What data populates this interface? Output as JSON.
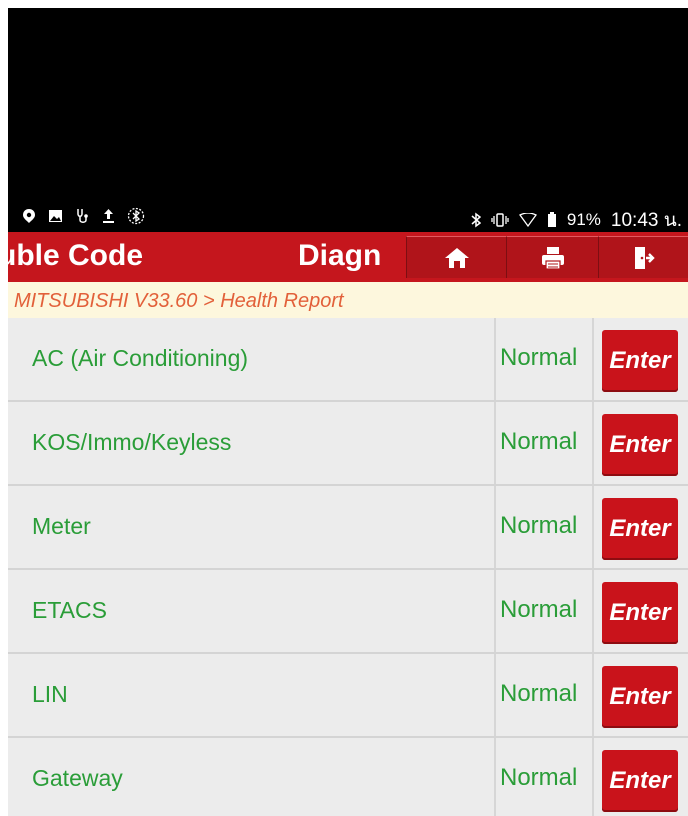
{
  "statusbar": {
    "left_icons": [
      "location-pin-icon",
      "image-icon",
      "stethoscope-icon",
      "upload-icon",
      "bluetooth-circle-icon"
    ],
    "bluetooth_icon": "bluetooth-icon",
    "vibrate_icon": "vibrate-icon",
    "wifi_icon": "wifi-icon",
    "battery_icon": "battery-icon",
    "battery": "91%",
    "time": "10:43 น."
  },
  "toolbar": {
    "title_part1": "uble Code",
    "title_part2": "Diagn",
    "home_icon": "home-icon",
    "print_icon": "printer-icon",
    "exit_icon": "exit-icon"
  },
  "breadcrumb": "MITSUBISHI V33.60 > Health Report",
  "systems": [
    {
      "name": "AC (Air Conditioning)",
      "status": "Normal",
      "button": "Enter"
    },
    {
      "name": "KOS/Immo/Keyless",
      "status": "Normal",
      "button": "Enter"
    },
    {
      "name": "Meter",
      "status": "Normal",
      "button": "Enter"
    },
    {
      "name": "ETACS",
      "status": "Normal",
      "button": "Enter"
    },
    {
      "name": "LIN",
      "status": "Normal",
      "button": "Enter"
    },
    {
      "name": "Gateway",
      "status": "Normal",
      "button": "Enter"
    }
  ],
  "colors": {
    "accent_red": "#c5161d",
    "status_green": "#2a9d38",
    "breadcrumb_text": "#e2603a",
    "breadcrumb_bg": "#fdf7dd"
  }
}
